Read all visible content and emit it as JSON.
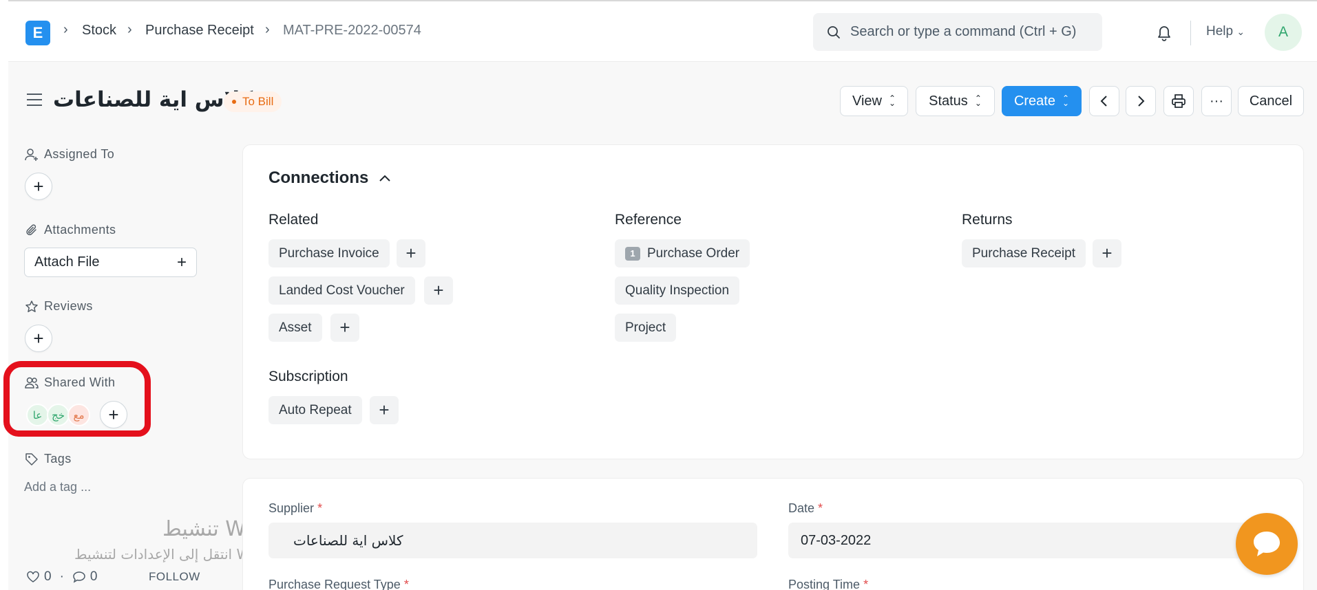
{
  "navbar": {
    "logo_letter": "E",
    "breadcrumbs": [
      "Stock",
      "Purchase Receipt",
      "MAT-PRE-2022-00574"
    ],
    "search_placeholder": "Search or type a command (Ctrl + G)",
    "help_label": "Help",
    "avatar_initial": "A"
  },
  "page": {
    "title": "كلاس اية للصناعات",
    "status": "To Bill",
    "actions": {
      "view": "View",
      "status": "Status",
      "create": "Create",
      "cancel": "Cancel",
      "more": "···"
    }
  },
  "sidebar": {
    "assigned_to": "Assigned To",
    "attachments": "Attachments",
    "attach_file": "Attach File",
    "reviews": "Reviews",
    "shared_with": "Shared With",
    "shared_users": [
      {
        "initials": "عا",
        "bg": "#e4f5e9",
        "fg": "#30a66d"
      },
      {
        "initials": "خج",
        "bg": "#e4f5e9",
        "fg": "#30a66d"
      },
      {
        "initials": "مع",
        "bg": "#fde5e1",
        "fg": "#e2794c"
      }
    ],
    "tags": "Tags",
    "add_tag": "Add a tag ...",
    "likes": "0",
    "comments": "0",
    "follow": "FOLLOW"
  },
  "watermark": {
    "line1": "تنشيط Windows",
    "line2": "انتقل إلى الإعدادات لتنشيط Windows."
  },
  "connections": {
    "title": "Connections",
    "related": {
      "title": "Related",
      "items": [
        "Purchase Invoice",
        "Landed Cost Voucher",
        "Asset"
      ]
    },
    "reference": {
      "title": "Reference",
      "items": [
        "Purchase Order",
        "Quality Inspection",
        "Project"
      ],
      "purchase_order_count": "1"
    },
    "returns": {
      "title": "Returns",
      "items": [
        "Purchase Receipt"
      ]
    },
    "subscription": {
      "title": "Subscription",
      "items": [
        "Auto Repeat"
      ]
    }
  },
  "form": {
    "supplier_label": "Supplier",
    "supplier_value": "كلاس اية للصناعات",
    "date_label": "Date",
    "date_value": "07-03-2022",
    "purchase_request_type_label": "Purchase Request Type",
    "posting_time_label": "Posting Time",
    "required_mark": "*"
  },
  "colors": {
    "primary": "#2490ef",
    "status": "#e86c13",
    "highlight": "#e4101c",
    "chat": "#f1961f"
  }
}
